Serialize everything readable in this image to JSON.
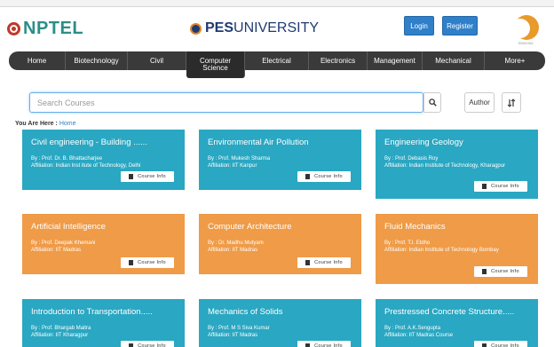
{
  "header": {
    "logo_text": "NPTEL",
    "university_bold": "PES",
    "university_rest": "UNIVERSITY",
    "login_label": "Login",
    "register_label": "Register",
    "mascot_caption": "SWAYAM"
  },
  "nav": {
    "items": [
      {
        "label": "Home"
      },
      {
        "label": "Biotechnology"
      },
      {
        "label": "Civil"
      },
      {
        "label_line1": "Computer",
        "label_line2": "Science"
      },
      {
        "label": "Electrical"
      },
      {
        "label": "Electronics"
      },
      {
        "label": "Management"
      },
      {
        "label": "Mechanical"
      },
      {
        "label": "More+"
      }
    ]
  },
  "search": {
    "placeholder": "Search Courses",
    "search_icon": "magnifier-icon",
    "author_label": "Author",
    "sort_icon": "sort-icon"
  },
  "breadcrumb": {
    "prefix": "You Are Here :",
    "current": "Home"
  },
  "course_info_label": "Course  Info",
  "cards": [
    {
      "title": "Civil engineering - Building ......",
      "by": "By : Prof. Dr. B. Bhattacharjee",
      "affiliation": "Affiliation: Indian Inst itute of Technology, Delhi",
      "color": "#2aa7c2"
    },
    {
      "title": "Environmental Air Pollution",
      "by": "By : Prof. Mukesh Sharma",
      "affiliation": "Affiliation: IIT Kanpur",
      "color": "#2aa7c2"
    },
    {
      "title": "Engineering Geology",
      "by": "By : Prof. Debasis Roy",
      "affiliation": "Affiliation: Indian Institute of Technology, Kharagpur",
      "color": "#2aa7c2"
    },
    {
      "title": "Artificial Intelligence",
      "by": "By : Prof. Deepak Khemani",
      "affiliation": "Affiliation: IIT Madras",
      "color": "#ef9b47"
    },
    {
      "title": "Computer Architecture",
      "by": "By : Dr. Madhu Mutyam",
      "affiliation": "Affiliation: IIT Madras",
      "color": "#ef9b47"
    },
    {
      "title": "Fluid Mechanics",
      "by": "By : Prof. T.I. Eldho",
      "affiliation": "Affiliation: Indian Institute of Technology Bombay",
      "color": "#ef9b47"
    },
    {
      "title": "Introduction to Transportation.....",
      "by": "By : Prof. Bhargab Maitra",
      "affiliation": "Affiliation: IIT Kharagpur",
      "color": "#2aa7c2"
    },
    {
      "title": "Mechanics of Solids",
      "by": "By : Prof. M S Siva Kumar",
      "affiliation": "Affiliation: IIT Madras",
      "color": "#2aa7c2"
    },
    {
      "title": "Prestressed Concrete Structure.....",
      "by": "By : Prof. A.K.Sengupta",
      "affiliation": "Affiliation: IIT Madras Course",
      "color": "#2aa7c2"
    }
  ]
}
